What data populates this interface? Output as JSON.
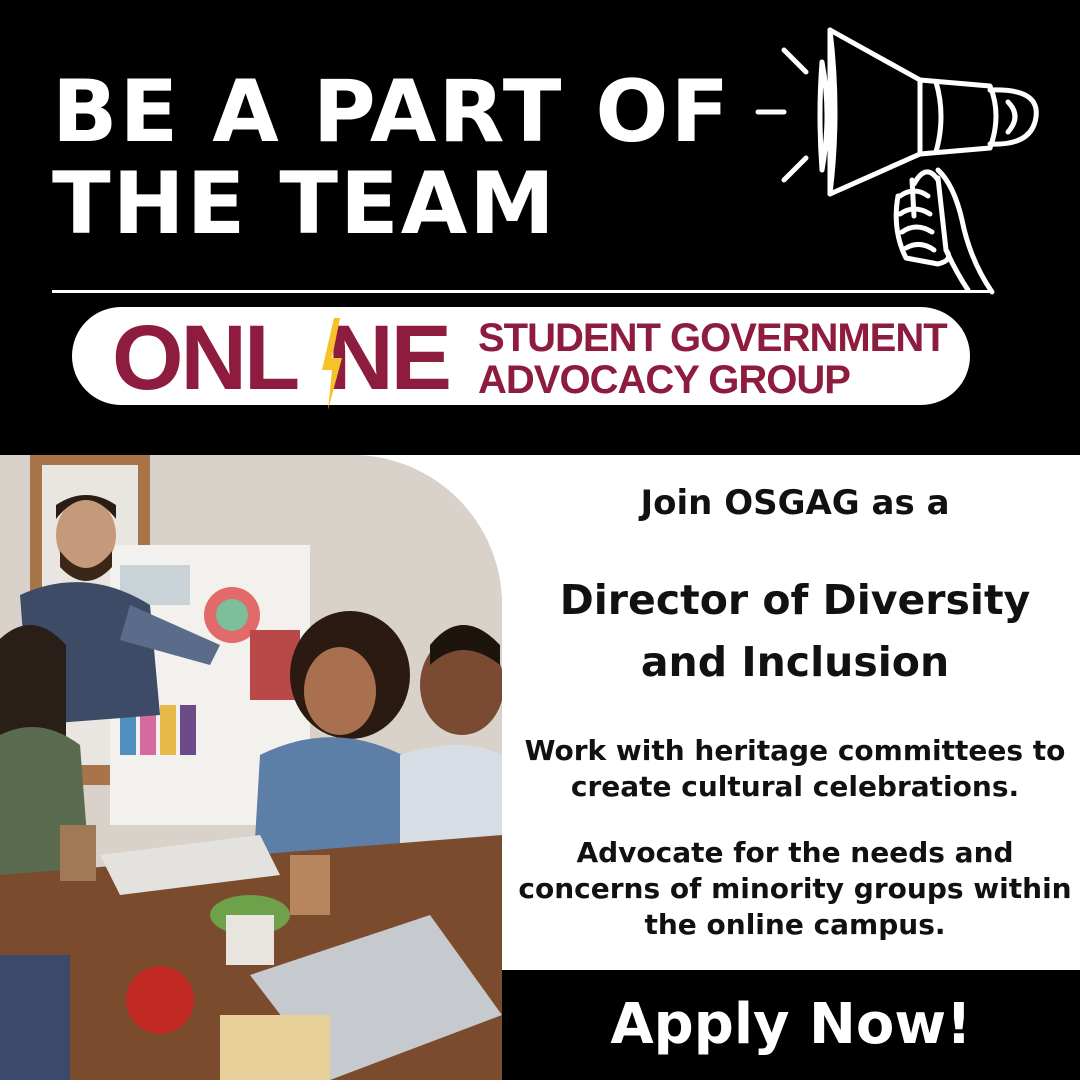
{
  "headline": {
    "line1": "BE A PART OF",
    "line2": "THE TEAM"
  },
  "logo": {
    "online_left": "ONL",
    "online_right": "NE",
    "line1": "STUDENT GOVERNMENT",
    "line2": "ADVOCACY GROUP"
  },
  "content": {
    "lead": "Join OSGAG as a",
    "role_line1": "Director of Diversity",
    "role_line2": "and Inclusion",
    "body1_line1": "Work with heritage committees to",
    "body1_line2": "create cultural celebrations.",
    "body2_line1": "Advocate for the needs and",
    "body2_line2": "concerns of minority groups within",
    "body2_line3": "the online campus."
  },
  "cta": {
    "label": "Apply Now!"
  },
  "colors": {
    "background": "#000000",
    "brand_maroon": "#8d1c3f",
    "bolt_yellow": "#f6c229",
    "text_dark": "#111111",
    "panel": "#ffffff"
  },
  "icons": {
    "megaphone": "megaphone-icon",
    "bolt": "lightning-bolt-icon"
  }
}
